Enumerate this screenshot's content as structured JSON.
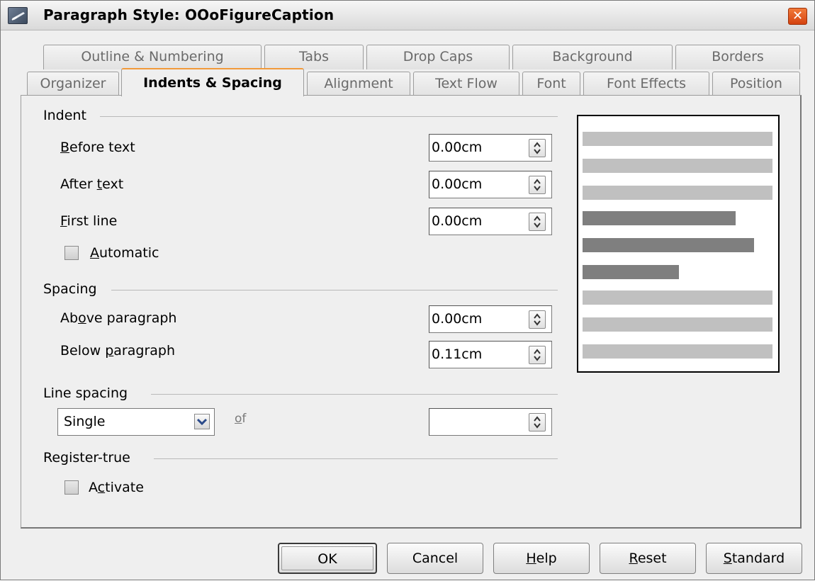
{
  "window": {
    "title": "Paragraph Style: OOoFigureCaption",
    "close_glyph": "✕"
  },
  "tabs_back": [
    "Outline & Numbering",
    "Tabs",
    "Drop Caps",
    "Background",
    "Borders"
  ],
  "tabs_front": [
    "Organizer",
    "Indents & Spacing",
    "Alignment",
    "Text Flow",
    "Font",
    "Font Effects",
    "Position"
  ],
  "active_tab": "Indents & Spacing",
  "indent": {
    "section": "Indent",
    "before_text": {
      "label_pre": "",
      "label_u": "B",
      "label_post": "efore text",
      "value": "0.00cm"
    },
    "after_text": {
      "label_pre": "After ",
      "label_u": "t",
      "label_post": "ext",
      "value": "0.00cm"
    },
    "first_line": {
      "label_pre": "",
      "label_u": "F",
      "label_post": "irst line",
      "value": "0.00cm"
    },
    "automatic": {
      "label_pre": "",
      "label_u": "A",
      "label_post": "utomatic",
      "checked": false
    }
  },
  "spacing": {
    "section": "Spacing",
    "above": {
      "label_pre": "Ab",
      "label_u": "o",
      "label_post": "ve paragraph",
      "value": "0.00cm"
    },
    "below": {
      "label_pre": "Below ",
      "label_u": "p",
      "label_post": "aragraph",
      "value": "0.11cm"
    }
  },
  "line_spacing": {
    "section": "Line spacing",
    "selected": "Single",
    "of_u": "o",
    "of_post": "f",
    "value": ""
  },
  "register_true": {
    "section": "Register-true",
    "activate": {
      "label_pre": "A",
      "label_u": "c",
      "label_post": "tivate",
      "checked": false
    }
  },
  "buttons": {
    "ok": "OK",
    "cancel": "Cancel",
    "help": {
      "u": "H",
      "post": "elp"
    },
    "reset": {
      "u": "R",
      "post": "eset"
    },
    "standard": {
      "u": "S",
      "post": "tandard"
    }
  },
  "icons": {
    "app": "paragraph-style-icon",
    "close": "close-icon",
    "spin": "spin-arrows-icon",
    "dropdown": "chevron-down-icon"
  },
  "colors": {
    "active_tab_accent": "#f29a3a",
    "close_button": "#d4420f",
    "preview_light_line": "#c0c0c0",
    "preview_dark_line": "#7f7f7f"
  }
}
